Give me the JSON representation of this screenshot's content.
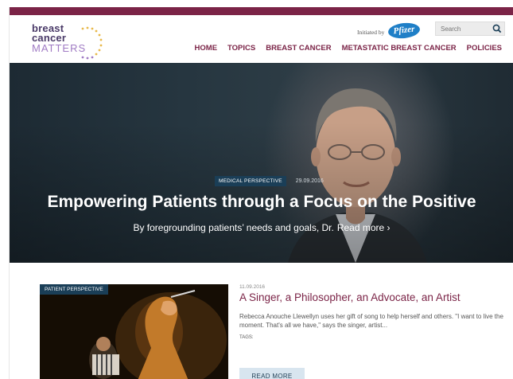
{
  "header": {
    "logo": {
      "line1": "breast",
      "line2": "cancer",
      "line3": "MATTERS"
    },
    "initiated_by": "Initiated by",
    "sponsor": "Pfizer",
    "search": {
      "placeholder": "Search"
    },
    "nav": [
      {
        "label": "HOME"
      },
      {
        "label": "TOPICS"
      },
      {
        "label": "BREAST CANCER"
      },
      {
        "label": "METASTATIC BREAST CANCER"
      },
      {
        "label": "POLICIES"
      }
    ]
  },
  "hero": {
    "category": "MEDICAL PERSPECTIVE",
    "date": "29.09.2016",
    "title": "Empowering Patients through a Focus on the Positive",
    "subtitle": "By foregrounding patients’ needs and goals, Dr.",
    "read_more": "Read more ›"
  },
  "article": {
    "category": "PATIENT PERSPECTIVE",
    "date": "11.09.2016",
    "title": "A Singer, a Philosopher, an Advocate, an Artist",
    "excerpt": "Rebecca Anouche Llewellyn uses her gift of song to help herself and others. \"I want to live the moment. That's all we have,\" says the singer, artist...",
    "tags_label": "TAGS:",
    "read_more": "READ MORE"
  },
  "colors": {
    "brand": "#7b2447",
    "badge": "#1a3e57",
    "logo_purple": "#a07bc4",
    "pfizer_blue": "#1f7fc7",
    "button_bg": "#d8e5ef"
  }
}
